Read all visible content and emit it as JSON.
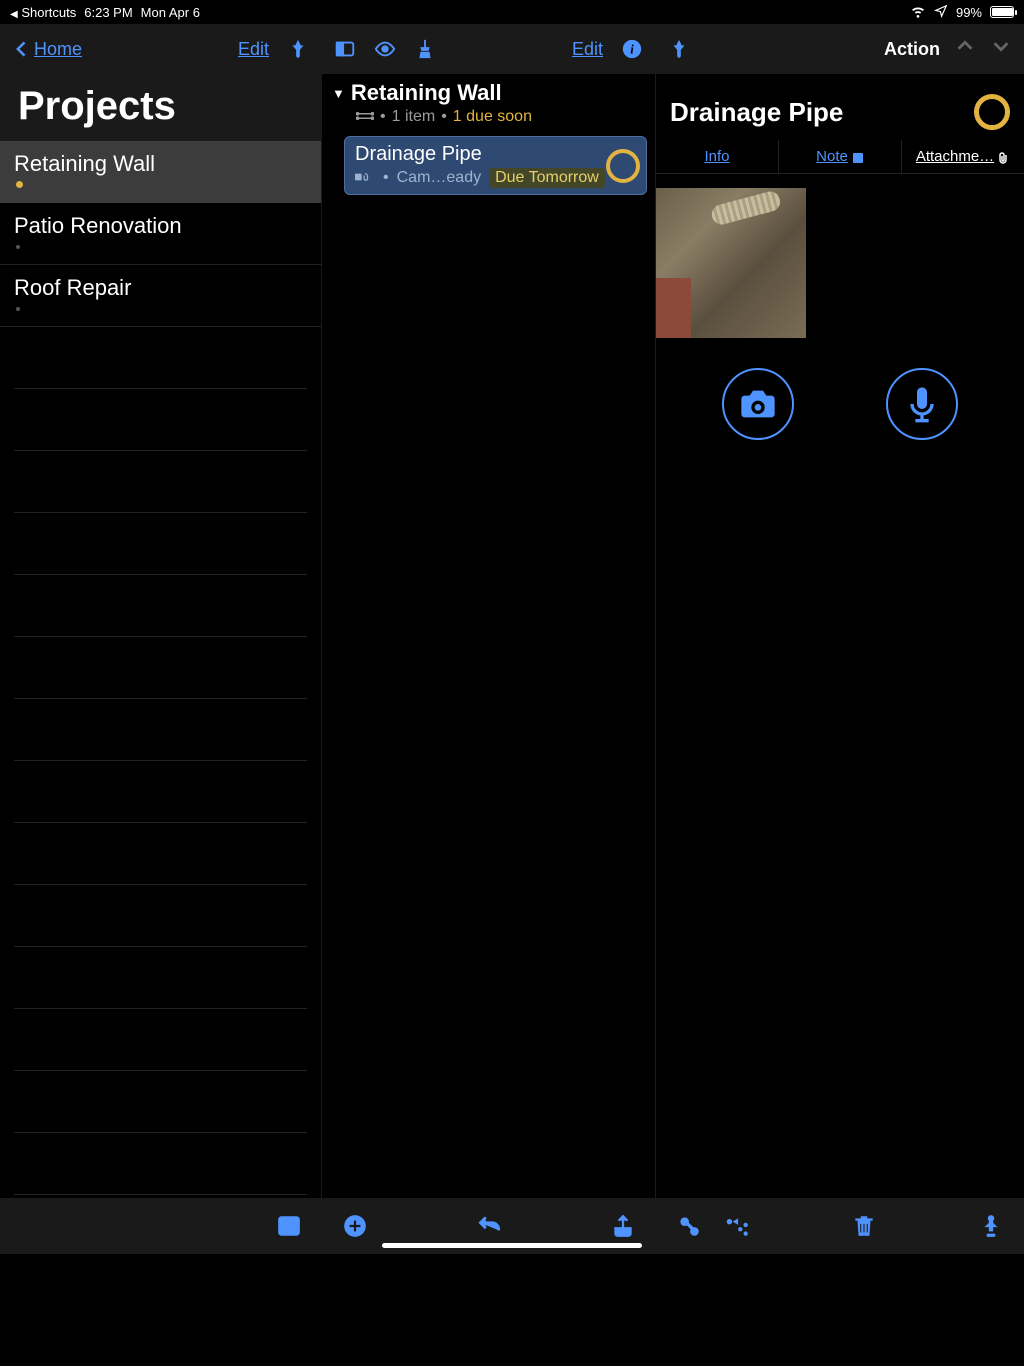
{
  "status": {
    "back_app": "Shortcuts",
    "time": "6:23 PM",
    "date": "Mon Apr 6",
    "battery_pct": "99%"
  },
  "col1": {
    "home_label": "Home",
    "edit_label": "Edit",
    "title": "Projects",
    "projects": [
      {
        "name": "Retaining Wall",
        "selected": true,
        "dot": true
      },
      {
        "name": "Patio Renovation",
        "selected": false,
        "dot": false
      },
      {
        "name": "Roof Repair",
        "selected": false,
        "dot": false
      }
    ]
  },
  "col2": {
    "edit_label": "Edit",
    "group_title": "Retaining Wall",
    "item_count": "1 item",
    "due_badge": "1 due soon",
    "task": {
      "title": "Drainage Pipe",
      "meta": "Cam…eady",
      "due": "Due Tomorrow"
    }
  },
  "col3": {
    "action_label": "Action",
    "title": "Drainage Pipe",
    "tabs": {
      "info": "Info",
      "note": "Note",
      "attachments": "Attachme…"
    }
  }
}
